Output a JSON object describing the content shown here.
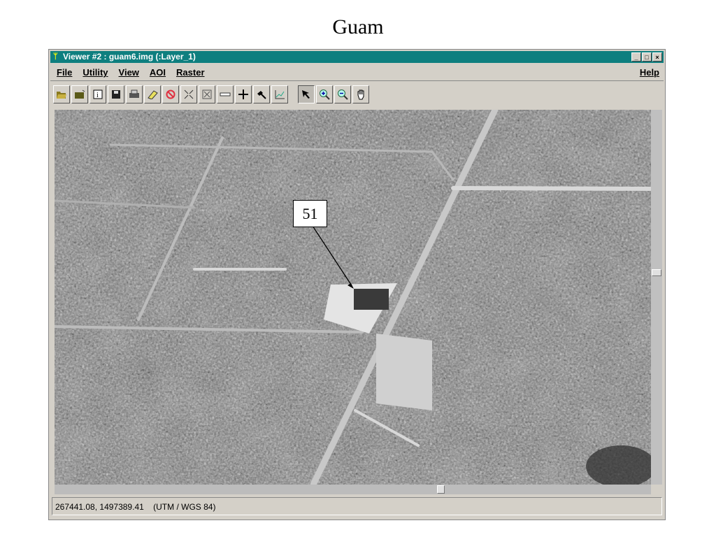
{
  "page_title": "Guam",
  "window": {
    "title": "Viewer #2 : guam6.img (:Layer_1)",
    "controls": [
      "_",
      "□",
      "×"
    ]
  },
  "menu": {
    "items": [
      "File",
      "Utility",
      "View",
      "AOI",
      "Raster"
    ],
    "help": "Help"
  },
  "toolbar": {
    "tools": [
      "open-layer",
      "open-folder",
      "layer-info",
      "save",
      "print",
      "eraser",
      "clear",
      "zoom-fit",
      "full-extent",
      "measure",
      "inquire-cursor",
      "annotate",
      "profile"
    ],
    "pointer_tools": [
      "select",
      "zoom-in",
      "zoom-out",
      "pan"
    ],
    "active_tool": "select"
  },
  "map": {
    "annotation": "51"
  },
  "status": {
    "coordinates": "267441.08, 1497389.41",
    "projection": "(UTM / WGS 84)"
  }
}
